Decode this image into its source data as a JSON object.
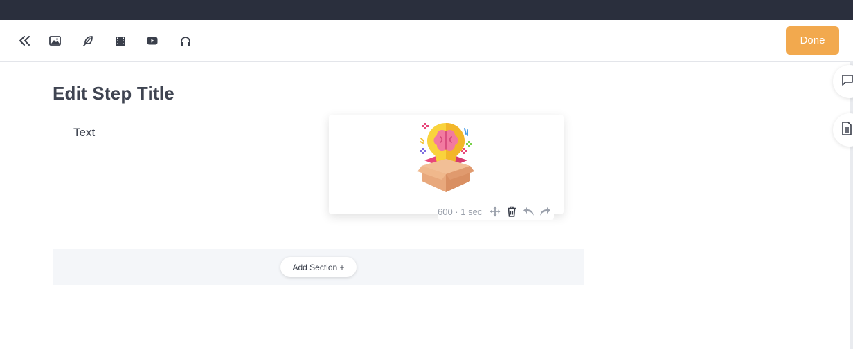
{
  "colors": {
    "topbar": "#2a2f3d",
    "done_button": "#f2a94e",
    "add_section_bg": "#f4f6f9",
    "title_text": "#3f4451"
  },
  "toolbar": {
    "icons": [
      "collapse-double-chevron-icon",
      "image-icon",
      "feather-icon",
      "film-icon",
      "youtube-icon",
      "headphones-icon"
    ],
    "done_label": "Done"
  },
  "side_actions": {
    "icons": [
      "comment-icon",
      "document-icon"
    ]
  },
  "step": {
    "title": "Edit Step Title",
    "text_label": "Text"
  },
  "media": {
    "image_icon": "brain-lightbulb-box-icon",
    "meta": "600 · 1 sec",
    "actions": [
      "move-icon",
      "trash-icon",
      "undo-icon",
      "redo-icon"
    ]
  },
  "add_section": {
    "label": "Add Section +"
  }
}
